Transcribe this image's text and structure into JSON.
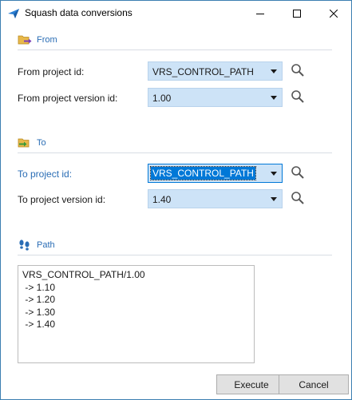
{
  "window": {
    "title": "Squash data conversions",
    "controls": {
      "minimize": "minimize",
      "maximize": "maximize",
      "close": "close"
    }
  },
  "from": {
    "section_label": "From",
    "project_id_label": "From project id:",
    "project_id_value": "VRS_CONTROL_PATH",
    "version_label": "From project version id:",
    "version_value": "1.00"
  },
  "to": {
    "section_label": "To",
    "project_id_label": "To project id:",
    "project_id_value": "VRS_CONTROL_PATH",
    "version_label": "To project version id:",
    "version_value": "1.40"
  },
  "path": {
    "section_label": "Path",
    "lines": [
      "VRS_CONTROL_PATH/1.00",
      " -> 1.10",
      " -> 1.20",
      " -> 1.30",
      " -> 1.40"
    ]
  },
  "buttons": {
    "execute": "Execute",
    "cancel": "Cancel"
  },
  "icons": {
    "app": "paper-plane-icon",
    "from": "folder-export-icon",
    "to": "folder-import-icon",
    "path": "footsteps-icon",
    "search": "magnifier-icon"
  },
  "colors": {
    "accent": "#2a6db5",
    "combo_bg": "#cde3f7",
    "selection": "#0078d7"
  }
}
